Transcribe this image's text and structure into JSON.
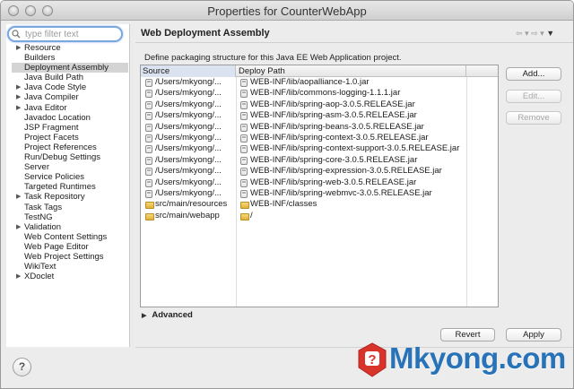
{
  "window": {
    "title": "Properties for CounterWebApp"
  },
  "filter": {
    "placeholder": "type filter text"
  },
  "sidebar": {
    "items": [
      {
        "label": "Resource",
        "expandable": true,
        "selected": false
      },
      {
        "label": "Builders",
        "expandable": false,
        "selected": false
      },
      {
        "label": "Deployment Assembly",
        "expandable": false,
        "selected": true
      },
      {
        "label": "Java Build Path",
        "expandable": false,
        "selected": false
      },
      {
        "label": "Java Code Style",
        "expandable": true,
        "selected": false
      },
      {
        "label": "Java Compiler",
        "expandable": true,
        "selected": false
      },
      {
        "label": "Java Editor",
        "expandable": true,
        "selected": false
      },
      {
        "label": "Javadoc Location",
        "expandable": false,
        "selected": false
      },
      {
        "label": "JSP Fragment",
        "expandable": false,
        "selected": false
      },
      {
        "label": "Project Facets",
        "expandable": false,
        "selected": false
      },
      {
        "label": "Project References",
        "expandable": false,
        "selected": false
      },
      {
        "label": "Run/Debug Settings",
        "expandable": false,
        "selected": false
      },
      {
        "label": "Server",
        "expandable": false,
        "selected": false
      },
      {
        "label": "Service Policies",
        "expandable": false,
        "selected": false
      },
      {
        "label": "Targeted Runtimes",
        "expandable": false,
        "selected": false
      },
      {
        "label": "Task Repository",
        "expandable": true,
        "selected": false
      },
      {
        "label": "Task Tags",
        "expandable": false,
        "selected": false
      },
      {
        "label": "TestNG",
        "expandable": false,
        "selected": false
      },
      {
        "label": "Validation",
        "expandable": true,
        "selected": false
      },
      {
        "label": "Web Content Settings",
        "expandable": false,
        "selected": false
      },
      {
        "label": "Web Page Editor",
        "expandable": false,
        "selected": false
      },
      {
        "label": "Web Project Settings",
        "expandable": false,
        "selected": false
      },
      {
        "label": "WikiText",
        "expandable": false,
        "selected": false
      },
      {
        "label": "XDoclet",
        "expandable": true,
        "selected": false
      }
    ]
  },
  "page": {
    "heading": "Web Deployment Assembly",
    "description": "Define packaging structure for this Java EE Web Application project."
  },
  "table": {
    "columns": {
      "source": "Source",
      "deploy": "Deploy Path"
    },
    "rows": [
      {
        "source": "/Users/mkyong/...",
        "deploy": "WEB-INF/lib/aopalliance-1.0.jar",
        "src_icon": "jar-icon",
        "dst_icon": "jar-icon"
      },
      {
        "source": "/Users/mkyong/...",
        "deploy": "WEB-INF/lib/commons-logging-1.1.1.jar",
        "src_icon": "jar-icon",
        "dst_icon": "jar-icon"
      },
      {
        "source": "/Users/mkyong/...",
        "deploy": "WEB-INF/lib/spring-aop-3.0.5.RELEASE.jar",
        "src_icon": "jar-icon",
        "dst_icon": "jar-icon"
      },
      {
        "source": "/Users/mkyong/...",
        "deploy": "WEB-INF/lib/spring-asm-3.0.5.RELEASE.jar",
        "src_icon": "jar-icon",
        "dst_icon": "jar-icon"
      },
      {
        "source": "/Users/mkyong/...",
        "deploy": "WEB-INF/lib/spring-beans-3.0.5.RELEASE.jar",
        "src_icon": "jar-icon",
        "dst_icon": "jar-icon"
      },
      {
        "source": "/Users/mkyong/...",
        "deploy": "WEB-INF/lib/spring-context-3.0.5.RELEASE.jar",
        "src_icon": "jar-icon",
        "dst_icon": "jar-icon"
      },
      {
        "source": "/Users/mkyong/...",
        "deploy": "WEB-INF/lib/spring-context-support-3.0.5.RELEASE.jar",
        "src_icon": "jar-icon",
        "dst_icon": "jar-icon"
      },
      {
        "source": "/Users/mkyong/...",
        "deploy": "WEB-INF/lib/spring-core-3.0.5.RELEASE.jar",
        "src_icon": "jar-icon",
        "dst_icon": "jar-icon"
      },
      {
        "source": "/Users/mkyong/...",
        "deploy": "WEB-INF/lib/spring-expression-3.0.5.RELEASE.jar",
        "src_icon": "jar-icon",
        "dst_icon": "jar-icon"
      },
      {
        "source": "/Users/mkyong/...",
        "deploy": "WEB-INF/lib/spring-web-3.0.5.RELEASE.jar",
        "src_icon": "jar-icon",
        "dst_icon": "jar-icon"
      },
      {
        "source": "/Users/mkyong/...",
        "deploy": "WEB-INF/lib/spring-webmvc-3.0.5.RELEASE.jar",
        "src_icon": "jar-icon",
        "dst_icon": "jar-icon"
      },
      {
        "source": "src/main/resources",
        "deploy": "WEB-INF/classes",
        "src_icon": "folder-icon",
        "dst_icon": "folder-icon"
      },
      {
        "source": "src/main/webapp",
        "deploy": "/",
        "src_icon": "folder-icon",
        "dst_icon": "folder-icon"
      }
    ]
  },
  "buttons": {
    "add": "Add...",
    "edit": "Edit...",
    "remove": "Remove",
    "revert": "Revert",
    "apply": "Apply",
    "help": "?"
  },
  "advanced": {
    "label": "Advanced"
  },
  "watermark": {
    "text": "Mkyong.com",
    "color": "#2873b8",
    "logo_color": "#d9342b"
  }
}
